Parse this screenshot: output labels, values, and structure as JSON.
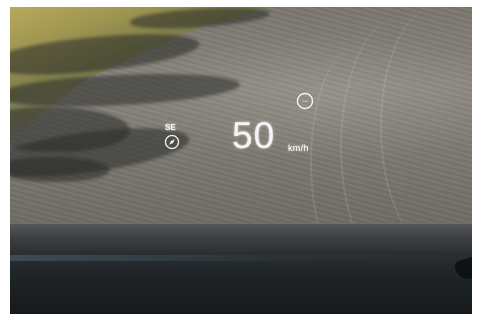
{
  "hud": {
    "speed": {
      "value": "50",
      "unit": "km/h"
    },
    "heading": {
      "label": "SE",
      "icon": "compass-icon"
    },
    "speed_limit": {
      "icon": "speed-limit-sign-icon",
      "text": "---"
    }
  },
  "colors": {
    "hud_text": "#f4f4f4",
    "dashboard": "#1f2427",
    "road": "#7a766e"
  }
}
